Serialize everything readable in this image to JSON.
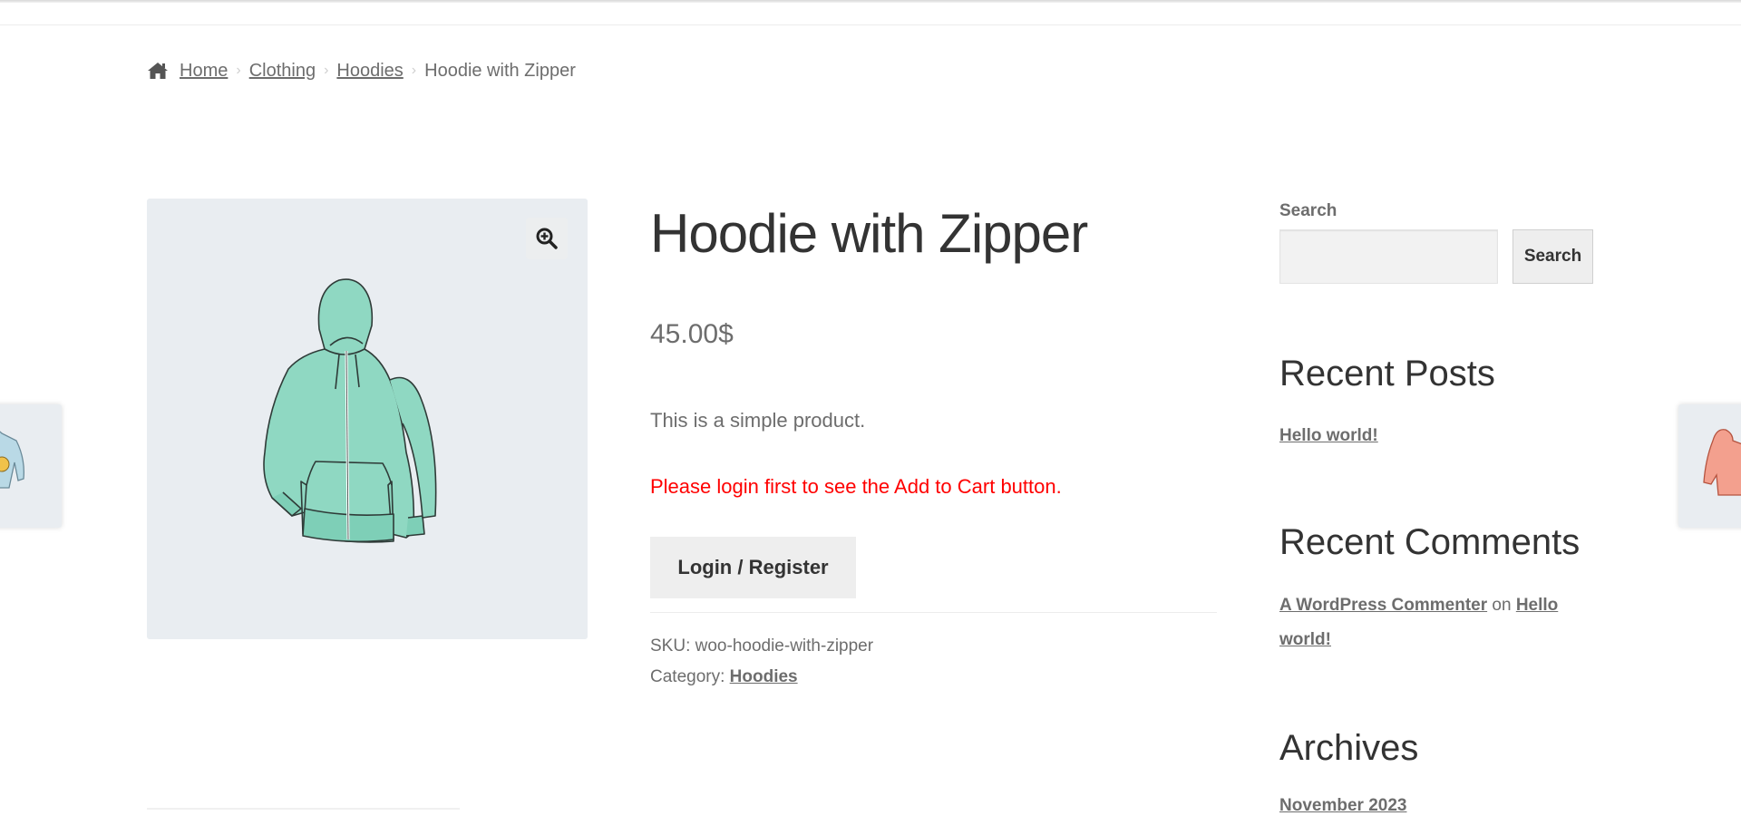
{
  "breadcrumb": {
    "home_icon": "home-icon",
    "items": [
      {
        "label": "Home",
        "link": true
      },
      {
        "label": "Clothing",
        "link": true
      },
      {
        "label": "Hoodies",
        "link": true
      },
      {
        "label": "Hoodie with Zipper",
        "link": false
      }
    ],
    "separator": "›"
  },
  "product": {
    "title": "Hoodie with Zipper",
    "price": "45.00$",
    "description": "This is a simple product.",
    "notice": "Please login first to see the Add to Cart button.",
    "login_button": "Login / Register",
    "sku_label": "SKU:",
    "sku_value": "woo-hoodie-with-zipper",
    "category_label": "Category:",
    "category_value": "Hoodies",
    "image_alt": "Mint green zip hoodie illustration",
    "zoom_icon": "zoom-in-icon"
  },
  "gallery_nav": {
    "prev_thumb": "Light blue hoodie with emoji patch",
    "next_thumb": "Coral pink hoodie"
  },
  "sidebar": {
    "search": {
      "label": "Search",
      "value": "",
      "placeholder": "",
      "button": "Search"
    },
    "recent_posts": {
      "title": "Recent Posts",
      "items": [
        "Hello world!"
      ]
    },
    "recent_comments": {
      "title": "Recent Comments",
      "author": "A WordPress Commenter",
      "connector": "on",
      "post": "Hello world!"
    },
    "archives": {
      "title": "Archives",
      "items": [
        "November 2023"
      ]
    }
  },
  "colors": {
    "notice": "#ff0000",
    "text": "#6d6d6d",
    "heading": "#333333",
    "gallery_bg": "#e9edf1",
    "button_bg": "#eeeeee"
  }
}
